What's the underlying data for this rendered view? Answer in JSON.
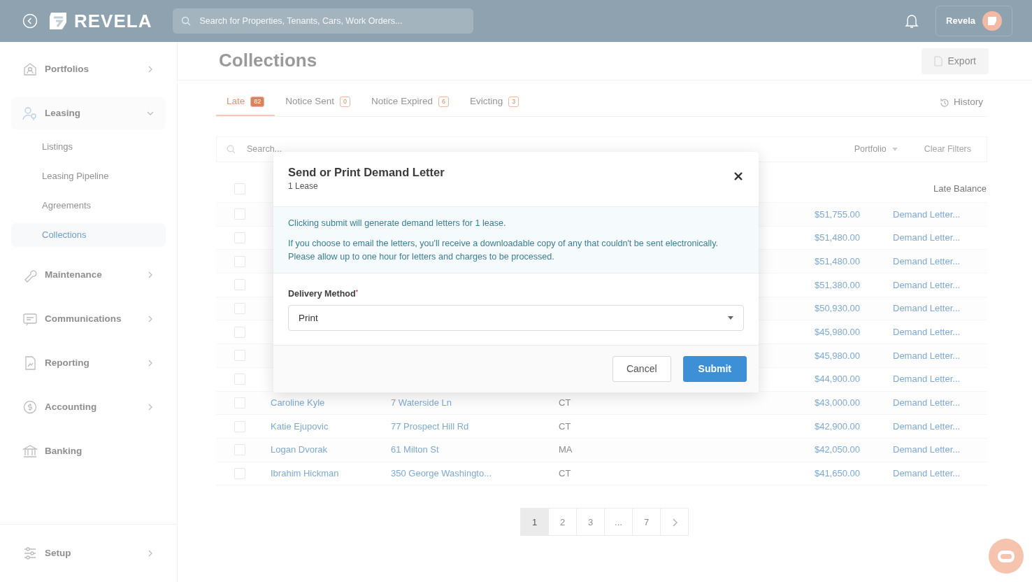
{
  "header": {
    "brand": "REVELA",
    "search": {
      "placeholder": "Search for Properties, Tenants, Cars, Work Orders..."
    },
    "account": "Revela"
  },
  "sidebar": {
    "items": [
      {
        "label": "Portfolios",
        "expanded": false
      },
      {
        "label": "Leasing",
        "expanded": true,
        "children": [
          {
            "label": "Listings",
            "selected": false
          },
          {
            "label": "Leasing Pipeline",
            "selected": false
          },
          {
            "label": "Agreements",
            "selected": false
          },
          {
            "label": "Collections",
            "selected": true
          }
        ]
      },
      {
        "label": "Maintenance",
        "expanded": false
      },
      {
        "label": "Communications",
        "expanded": false
      },
      {
        "label": "Reporting",
        "expanded": false
      },
      {
        "label": "Accounting",
        "expanded": false
      },
      {
        "label": "Banking"
      }
    ],
    "footer_item": {
      "label": "Setup",
      "expanded": false
    }
  },
  "page": {
    "title": "Collections",
    "export_button": "Export",
    "tabs": [
      {
        "label": "Late",
        "count": "82",
        "selected": true
      },
      {
        "label": "Notice Sent",
        "count": "0",
        "selected": false
      },
      {
        "label": "Notice Expired",
        "count": "6",
        "selected": false
      },
      {
        "label": "Evicting",
        "count": "3",
        "selected": false
      }
    ],
    "history_button": "History",
    "filters": {
      "search": {
        "placeholder": "Search..."
      },
      "portfolio": "Portfolio",
      "clear": "Clear Filters"
    },
    "table": {
      "header_checked": false,
      "columns": [
        {
          "label": "Late Balance"
        }
      ],
      "rows": [
        {
          "checked": false,
          "balance": "$51,755.00",
          "action": "Demand Letter..."
        },
        {
          "checked": false,
          "balance": "$51,480.00",
          "action": "Demand Letter..."
        },
        {
          "checked": false,
          "balance": "$51,480.00",
          "action": "Demand Letter..."
        },
        {
          "checked": false,
          "balance": "$51,380.00",
          "action": "Demand Letter..."
        },
        {
          "checked": false,
          "balance": "$50,930.00",
          "action": "Demand Letter..."
        },
        {
          "checked": false,
          "balance": "$45,980.00",
          "action": "Demand Letter..."
        },
        {
          "checked": false,
          "balance": "$45,980.00",
          "action": "Demand Letter..."
        },
        {
          "checked": false,
          "balance": "$44,900.00",
          "action": "Demand Letter..."
        },
        {
          "checked": false,
          "name": "Caroline Kyle",
          "address": "7 Waterside Ln",
          "state": "CT",
          "balance": "$43,000.00",
          "action": "Demand Letter..."
        },
        {
          "checked": false,
          "name": "Katie Ejupovic",
          "address": "77 Prospect Hill Rd",
          "state": "CT",
          "balance": "$42,900.00",
          "action": "Demand Letter..."
        },
        {
          "checked": false,
          "name": "Logan Dvorak",
          "address": "61 Milton St",
          "state": "MA",
          "balance": "$42,050.00",
          "action": "Demand Letter..."
        },
        {
          "checked": false,
          "name": "Ibrahim Hickman",
          "address": "350 George Washingto...",
          "state": "CT",
          "balance": "$41,650.00",
          "action": "Demand Letter..."
        }
      ]
    },
    "pagination": {
      "pages": [
        {
          "label": "1",
          "selected": true
        },
        {
          "label": "2",
          "selected": false
        },
        {
          "label": "3",
          "selected": false
        },
        {
          "label": "...",
          "selected": false
        },
        {
          "label": "7",
          "selected": false
        }
      ]
    }
  },
  "modal": {
    "title": "Send or Print Demand Letter",
    "subtitle": "1 Lease",
    "info": [
      "Clicking submit will generate demand letters for 1 lease.",
      "If you choose to email the letters, you'll receive a downloadable copy of any that couldn't be sent electronically. Please allow up to one hour for letters and charges to be processed."
    ],
    "field": {
      "label": "Delivery Method",
      "required_mark": "*",
      "value": "Print"
    },
    "buttons": [
      {
        "label": "Cancel",
        "kind": "secondary"
      },
      {
        "label": "Submit",
        "kind": "primary"
      }
    ]
  }
}
